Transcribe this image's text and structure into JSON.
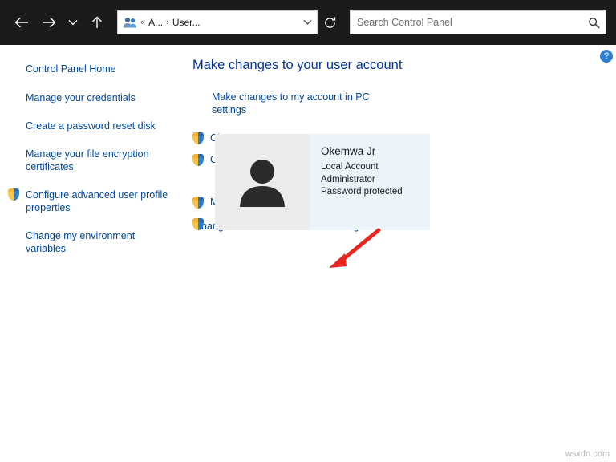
{
  "titlebar": {
    "back_icon": "back-arrow-icon",
    "forward_icon": "forward-arrow-icon",
    "recent_icon": "chevron-down-icon",
    "up_icon": "up-arrow-icon",
    "address": {
      "icon": "user-accounts-icon",
      "separator": "«",
      "segment1": "A...",
      "arrow": "›",
      "segment2": "User...",
      "dropdown_icon": "chevron-down-icon"
    },
    "refresh_icon": "refresh-icon",
    "search": {
      "placeholder": "Search Control Panel",
      "value": "",
      "icon": "search-icon"
    }
  },
  "sidebar": {
    "items": [
      {
        "label": "Control Panel Home",
        "shield": false
      },
      {
        "label": "Manage your credentials",
        "shield": false
      },
      {
        "label": "Create a password reset disk",
        "shield": false
      },
      {
        "label": "Manage your file encryption certificates",
        "shield": false
      },
      {
        "label": "Configure advanced user profile properties",
        "shield": true
      },
      {
        "label": "Change my environment variables",
        "shield": false
      }
    ]
  },
  "main": {
    "title": "Make changes to your user account",
    "pc_settings_link": "Make changes to my account in PC settings",
    "tasks": [
      {
        "label": "Change your account name",
        "shield": true
      },
      {
        "label": "Change your account type",
        "shield": true
      },
      {
        "label": "Manage another account",
        "shield": true
      }
    ],
    "uac_link": "Change User Account Control settings",
    "help_label": "?"
  },
  "account": {
    "avatar_icon": "user-avatar-icon",
    "name": "Okemwa Jr",
    "type": "Local Account",
    "role": "Administrator",
    "password": "Password protected"
  },
  "annotation": {
    "arrow_color": "#e8251f",
    "target": "Manage another account"
  },
  "watermark": "wsxdn.com"
}
